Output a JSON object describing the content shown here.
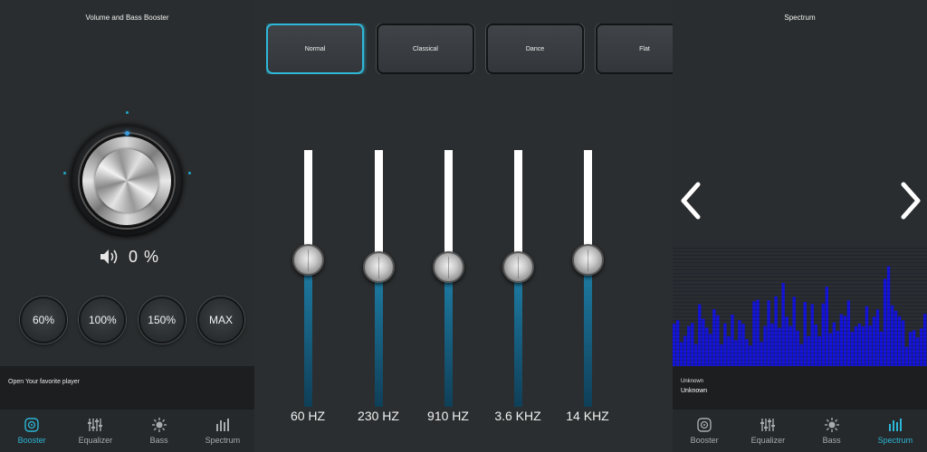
{
  "booster": {
    "title": "Volume and Bass Booster",
    "volume_percent": "0 %",
    "buttons": [
      "60%",
      "100%",
      "150%",
      "MAX"
    ],
    "player_hint": "Open Your favorite player"
  },
  "equalizer": {
    "presets": [
      {
        "label": "Normal",
        "active": true
      },
      {
        "label": "Classical",
        "active": false
      },
      {
        "label": "Dance",
        "active": false
      },
      {
        "label": "Flat",
        "active": false
      }
    ],
    "bands": [
      {
        "label": "60 HZ",
        "level": 0.5
      },
      {
        "label": "230 HZ",
        "level": 0.4
      },
      {
        "label": "910 HZ",
        "level": 0.4
      },
      {
        "label": "3.6 KHZ",
        "level": 0.4
      },
      {
        "label": "14 KHZ",
        "level": 0.5
      }
    ]
  },
  "spectrum": {
    "title": "Spectrum",
    "bar_color": "#1414dc",
    "track_artist": "Unknown",
    "track_title": "Unknown"
  },
  "tabs": [
    "Booster",
    "Equalizer",
    "Bass",
    "Spectrum"
  ],
  "colors": {
    "accent": "#2cb6d7",
    "eq_fill": "#1e7fa8",
    "spectrum": "#1414dc"
  }
}
